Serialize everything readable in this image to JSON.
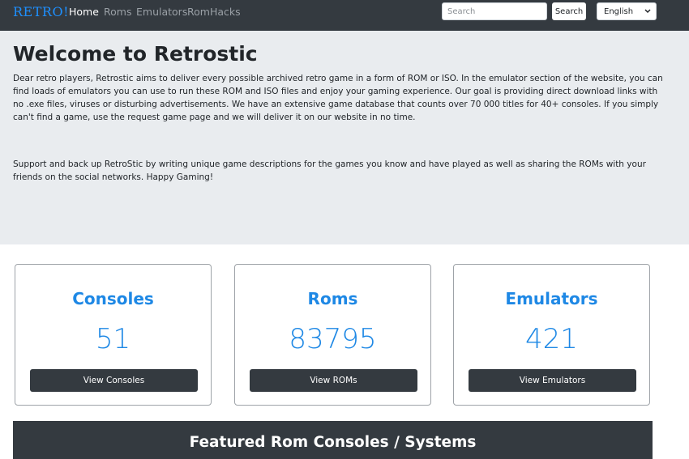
{
  "navbar": {
    "brand": "RETRO!",
    "links": [
      "Home",
      "Roms",
      "Emulators",
      "RomHacks"
    ],
    "search_placeholder": "Search",
    "search_button": "Search",
    "language": "English"
  },
  "hero": {
    "title": "Welcome to Retrostic",
    "paragraph1": "Dear retro players, Retrostic aims to deliver every possible archived retro game in a form of ROM or ISO. In the emulator section of the website, you can find loads of emulators you can use to run these ROM and ISO files and enjoy your gaming experience. Our goal is providing direct download links with no .exe files, viruses or disturbing advertisements. We have an extensive game database that counts over 70 000 titles for 40+ consoles. If you simply can't find a game, use the request game page and we will deliver it on our website in no time.",
    "paragraph2": "Support and back up RetroStic by writing unique game descriptions for the games you know and have played as well as sharing the ROMs with your friends on the social networks. Happy Gaming!"
  },
  "stats": [
    {
      "title": "Consoles",
      "count": "51",
      "button": "View Consoles"
    },
    {
      "title": "Roms",
      "count": "83795",
      "button": "View ROMs"
    },
    {
      "title": "Emulators",
      "count": "421",
      "button": "View Emulators"
    }
  ],
  "featured": {
    "title": "Featured Rom Consoles / Systems"
  },
  "colors": {
    "navbar_bg": "#343a40",
    "accent_blue": "#1e88e5",
    "hero_bg": "#e9ecef"
  }
}
